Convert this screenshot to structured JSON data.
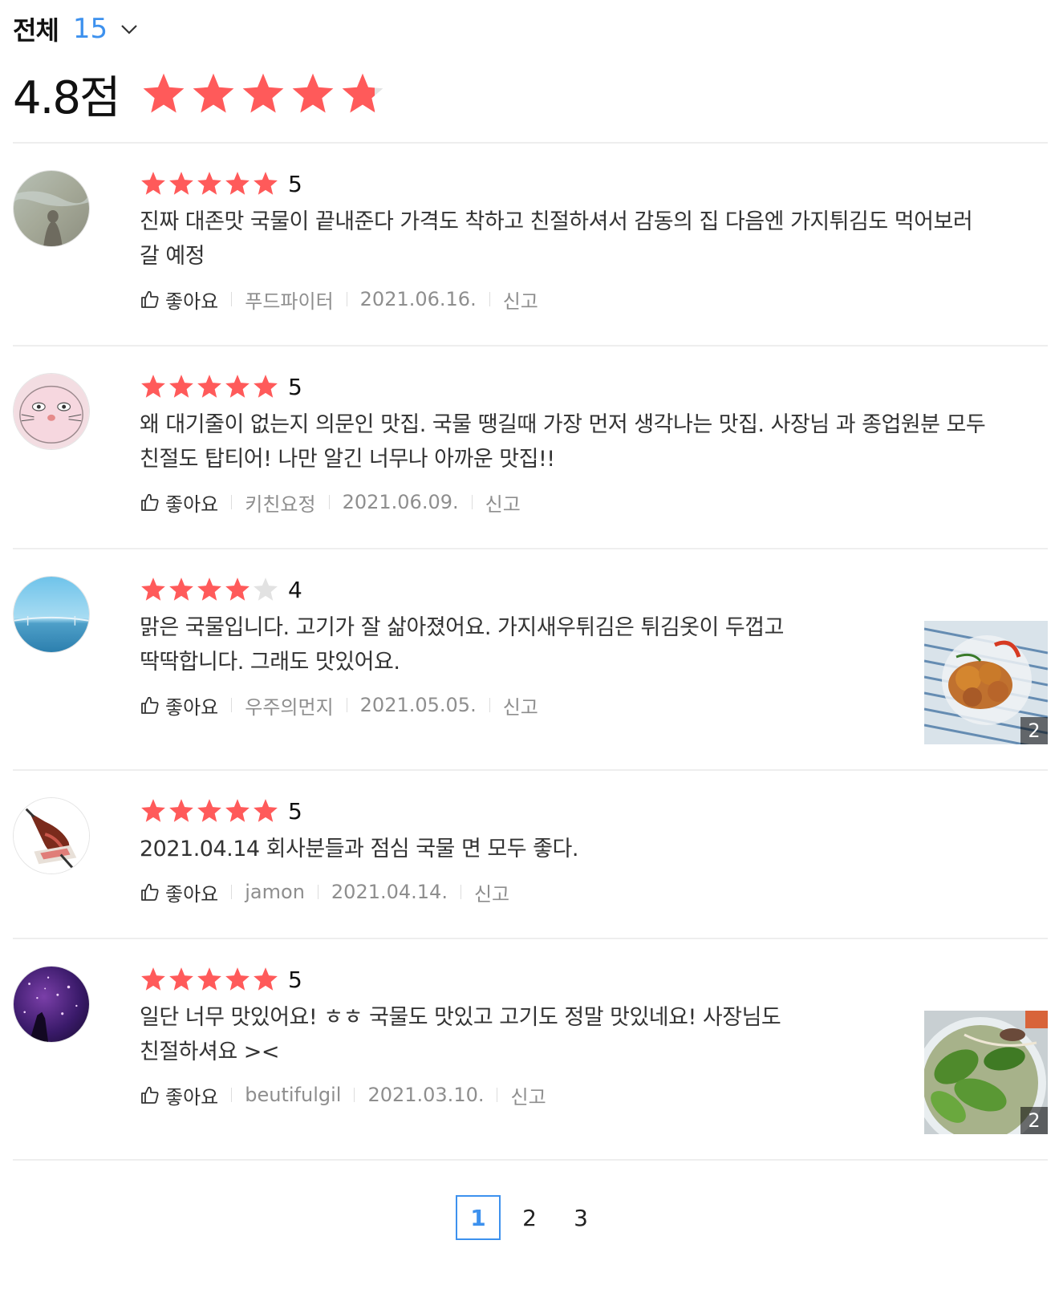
{
  "summary": {
    "filter_label": "전체",
    "count": "15",
    "average": "4.8점",
    "average_rating": 4.8,
    "star_color": "#ff5a5a",
    "accent_color": "#3d91ee"
  },
  "like_label": "좋아요",
  "report_label": "신고",
  "reviews": [
    {
      "rating": 5,
      "rating_text": "5",
      "text": "진짜 대존맛 국물이 끝내준다 가격도 착하고 친절하셔서 감동의 집 다음엔 가지튀김도 먹어보러 갈 예정",
      "author": "푸드파이터",
      "date": "2021.06.16.",
      "avatar": "beach-shadow-avatar"
    },
    {
      "rating": 5,
      "rating_text": "5",
      "text": "왜 대기줄이 없는지 의문인 맛집. 국물 땡길때 가장 먼저 생각나는 맛집.  사장님 과 종업원분 모두 친절도 탑티어! 나만 알긴 너무나 아까운 맛집!!",
      "author": "키친요정",
      "date": "2021.06.09.",
      "avatar": "pink-cat-avatar"
    },
    {
      "rating": 4,
      "rating_text": "4",
      "text": "맑은 국물입니다. 고기가 잘 삶아졌어요. 가지새우튀김은 튀김옷이 두껍고 딱딱합니다. 그래도 맛있어요.",
      "author": "우주의먼지",
      "date": "2021.05.05.",
      "avatar": "sky-bridge-avatar",
      "photo_count": "2",
      "photo": "fried-food-photo"
    },
    {
      "rating": 5,
      "rating_text": "5",
      "text": "2021.04.14 회사분들과 점심 국물 면 모두 좋다.",
      "author": "jamon",
      "date": "2021.04.14.",
      "avatar": "jamon-avatar"
    },
    {
      "rating": 5,
      "rating_text": "5",
      "text": "일단 너무 맛있어요! ㅎㅎ 국물도 맛있고 고기도 정말 맛있네요! 사장님도 친절하셔요 ><",
      "author": "beutifulgil",
      "date": "2021.03.10.",
      "avatar": "galaxy-avatar",
      "photo_count": "2",
      "photo": "noodle-soup-photo"
    }
  ],
  "pagination": {
    "pages": [
      "1",
      "2",
      "3"
    ],
    "current": "1"
  }
}
